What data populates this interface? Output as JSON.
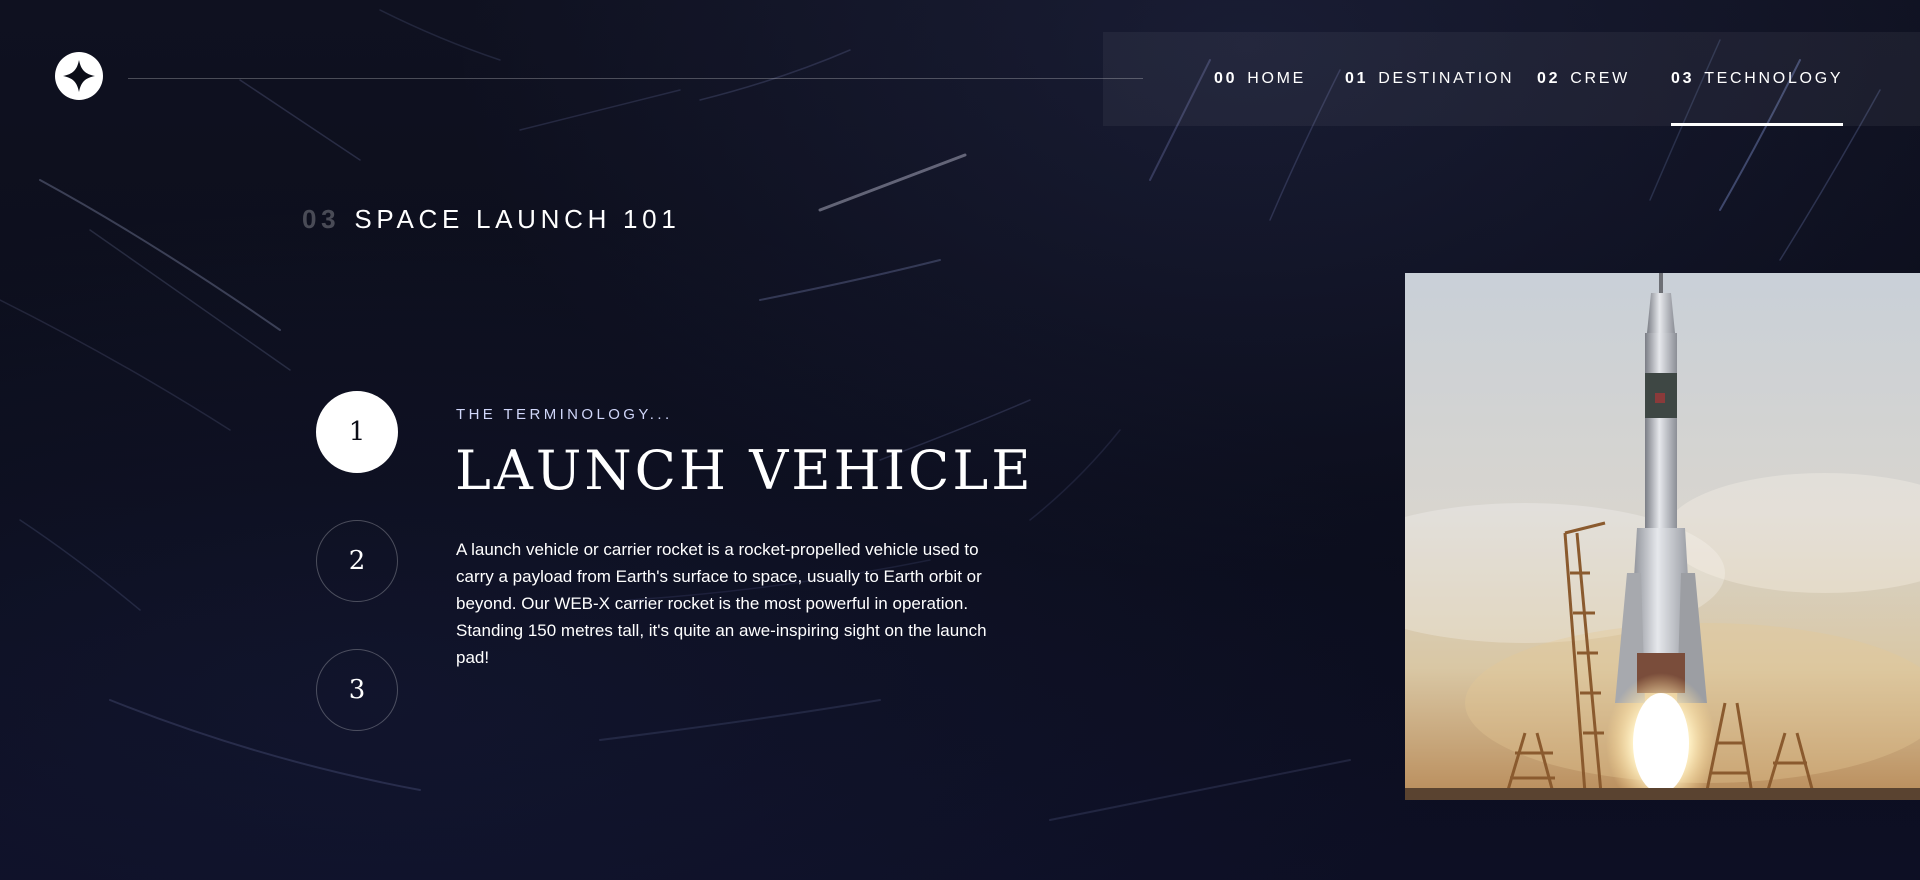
{
  "header": {
    "logo_icon": "star-icon"
  },
  "nav": {
    "items": [
      {
        "num": "00",
        "label": "HOME"
      },
      {
        "num": "01",
        "label": "DESTINATION"
      },
      {
        "num": "02",
        "label": "CREW"
      },
      {
        "num": "03",
        "label": "TECHNOLOGY"
      }
    ],
    "active_index": 3
  },
  "page": {
    "num": "03",
    "title": "SPACE LAUNCH 101"
  },
  "steps": {
    "items": [
      "1",
      "2",
      "3"
    ],
    "active_index": 0
  },
  "content": {
    "eyebrow": "THE TERMINOLOGY...",
    "title": "LAUNCH VEHICLE",
    "description": "A launch vehicle or carrier rocket is a rocket-propelled vehicle used to carry a payload from Earth's surface to space, usually to Earth orbit or beyond. Our WEB-X carrier rocket is the most powerful in operation. Standing 150 metres tall, it's quite an awe-inspiring sight on the launch pad!"
  },
  "colors": {
    "background": "#0b0d17",
    "accent": "#d0d6f9",
    "white": "#ffffff"
  }
}
